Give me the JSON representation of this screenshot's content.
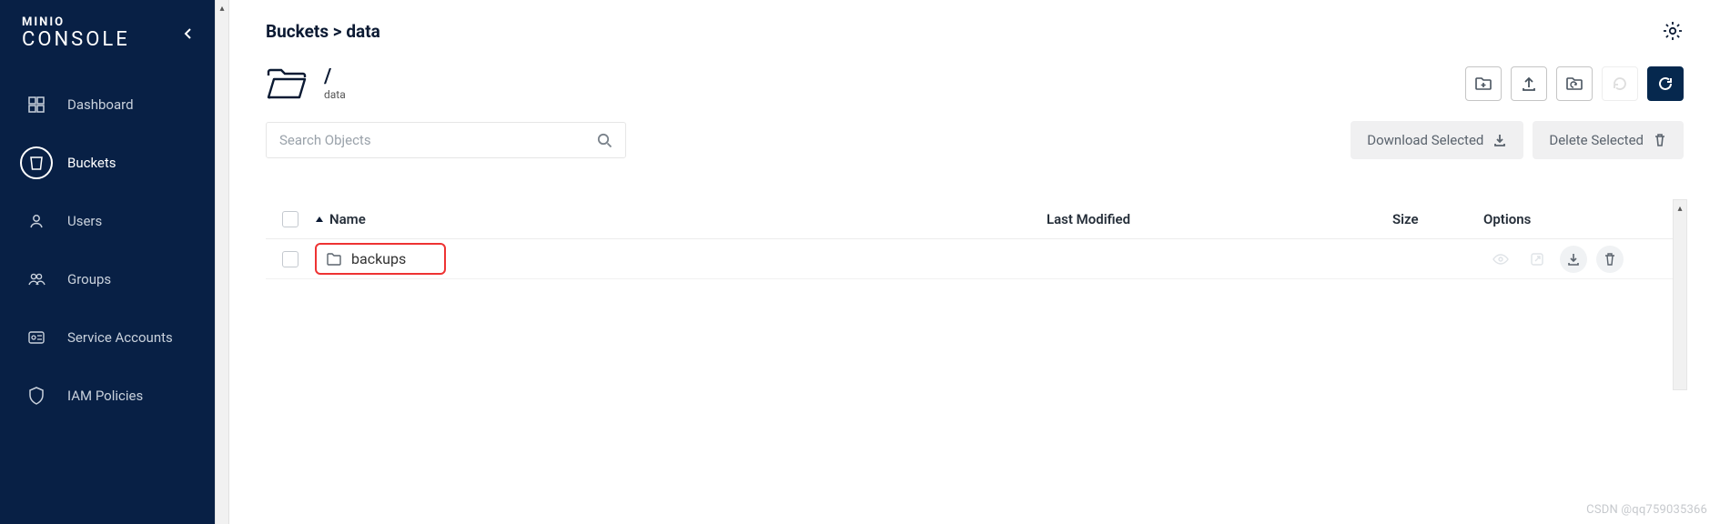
{
  "brand": {
    "top": "MINIO",
    "bottom": "CONSOLE"
  },
  "sidebar": {
    "items": [
      {
        "label": "Dashboard",
        "icon": "dashboard-icon"
      },
      {
        "label": "Buckets",
        "icon": "bucket-icon"
      },
      {
        "label": "Users",
        "icon": "user-icon"
      },
      {
        "label": "Groups",
        "icon": "groups-icon"
      },
      {
        "label": "Service Accounts",
        "icon": "service-accounts-icon"
      },
      {
        "label": "IAM Policies",
        "icon": "shield-icon"
      }
    ],
    "active_index": 1
  },
  "header": {
    "breadcrumb": "Buckets > data"
  },
  "path": {
    "display": "/",
    "label": "data"
  },
  "toolbar": {
    "buttons": [
      {
        "name": "new-folder-button",
        "icon": "folder-plus-icon"
      },
      {
        "name": "upload-button",
        "icon": "upload-icon"
      },
      {
        "name": "rewind-button",
        "icon": "rewind-folder-icon"
      },
      {
        "name": "refresh-ghost-button",
        "icon": "refresh-icon",
        "disabled": true
      },
      {
        "name": "refresh-button",
        "icon": "refresh-icon",
        "primary": true
      }
    ]
  },
  "search": {
    "placeholder": "Search Objects"
  },
  "bulk": {
    "download_label": "Download Selected",
    "delete_label": "Delete Selected"
  },
  "table": {
    "columns": {
      "name": "Name",
      "modified": "Last Modified",
      "size": "Size",
      "options": "Options"
    },
    "rows": [
      {
        "name": "backups",
        "type": "folder",
        "last_modified": "",
        "size": "",
        "highlight": true
      }
    ]
  },
  "watermark": "CSDN @qq759035366"
}
